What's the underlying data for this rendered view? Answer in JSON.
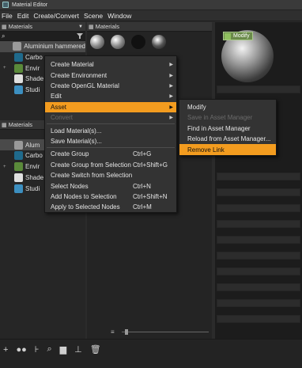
{
  "window": {
    "title": "Material Editor"
  },
  "menubar": [
    "File",
    "Edit",
    "Create/Convert",
    "Scene",
    "Window"
  ],
  "left_panel_top": {
    "header": "Materials",
    "items": [
      {
        "label": "Aluminium hammered",
        "color": "#9a9a9a"
      },
      {
        "label": "Carbo",
        "color": "#1f6a8c"
      },
      {
        "label": "Envir",
        "color": "#5a8a3a"
      },
      {
        "label": "Shade",
        "color": "#e0e0e0"
      },
      {
        "label": "Studi",
        "color": "#3c8fc0"
      }
    ]
  },
  "left_panel_bottom": {
    "header": "Materials",
    "items": [
      {
        "label": "Alum",
        "color": "#9a9a9a"
      },
      {
        "label": "Carbo",
        "color": "#1f6a8c"
      },
      {
        "label": "Envir",
        "color": "#5a8a3a"
      },
      {
        "label": "Shade",
        "color": "#e0e0e0"
      },
      {
        "label": "Studi",
        "color": "#3c8fc0"
      }
    ]
  },
  "mid_panel": {
    "header": "Materials"
  },
  "right_panel": {
    "badge": "Modify"
  },
  "context_menu": {
    "items": [
      {
        "label": "Create Material",
        "shortcut": "",
        "submenu": true,
        "state": "normal"
      },
      {
        "label": "Create Environment",
        "shortcut": "",
        "submenu": true,
        "state": "normal"
      },
      {
        "label": "Create OpenGL Material",
        "shortcut": "",
        "submenu": true,
        "state": "normal"
      },
      {
        "label": "Edit",
        "shortcut": "",
        "submenu": true,
        "state": "normal"
      },
      {
        "label": "Asset",
        "shortcut": "",
        "submenu": true,
        "state": "highlighted"
      },
      {
        "label": "Convert",
        "shortcut": "",
        "submenu": true,
        "state": "disabled"
      },
      {
        "label": "Load Material(s)...",
        "shortcut": "",
        "submenu": false,
        "state": "normal"
      },
      {
        "label": "Save Material(s)...",
        "shortcut": "",
        "submenu": false,
        "state": "normal"
      },
      {
        "label": "Create Group",
        "shortcut": "Ctrl+G",
        "submenu": false,
        "state": "normal"
      },
      {
        "label": "Create Group from Selection",
        "shortcut": "Ctrl+Shift+G",
        "submenu": false,
        "state": "normal"
      },
      {
        "label": "Create Switch from Selection",
        "shortcut": "",
        "submenu": false,
        "state": "normal"
      },
      {
        "label": "Select Nodes",
        "shortcut": "Ctrl+N",
        "submenu": false,
        "state": "normal"
      },
      {
        "label": "Add Nodes to Selection",
        "shortcut": "Ctrl+Shift+N",
        "submenu": false,
        "state": "normal"
      },
      {
        "label": "Apply to Selected Nodes",
        "shortcut": "Ctrl+M",
        "submenu": false,
        "state": "normal"
      }
    ]
  },
  "asset_submenu": {
    "items": [
      {
        "label": "Modify",
        "state": "normal"
      },
      {
        "label": "Save in Asset Manager",
        "state": "disabled"
      },
      {
        "label": "Find in Asset Manager",
        "state": "normal"
      },
      {
        "label": "Reload from Asset Manager...",
        "state": "normal"
      },
      {
        "label": "Remove Link",
        "state": "highlighted"
      }
    ]
  },
  "colors": {
    "highlight": "#f39c1f",
    "menu_bg": "#333333",
    "disabled_text": "#6b6b6b"
  }
}
